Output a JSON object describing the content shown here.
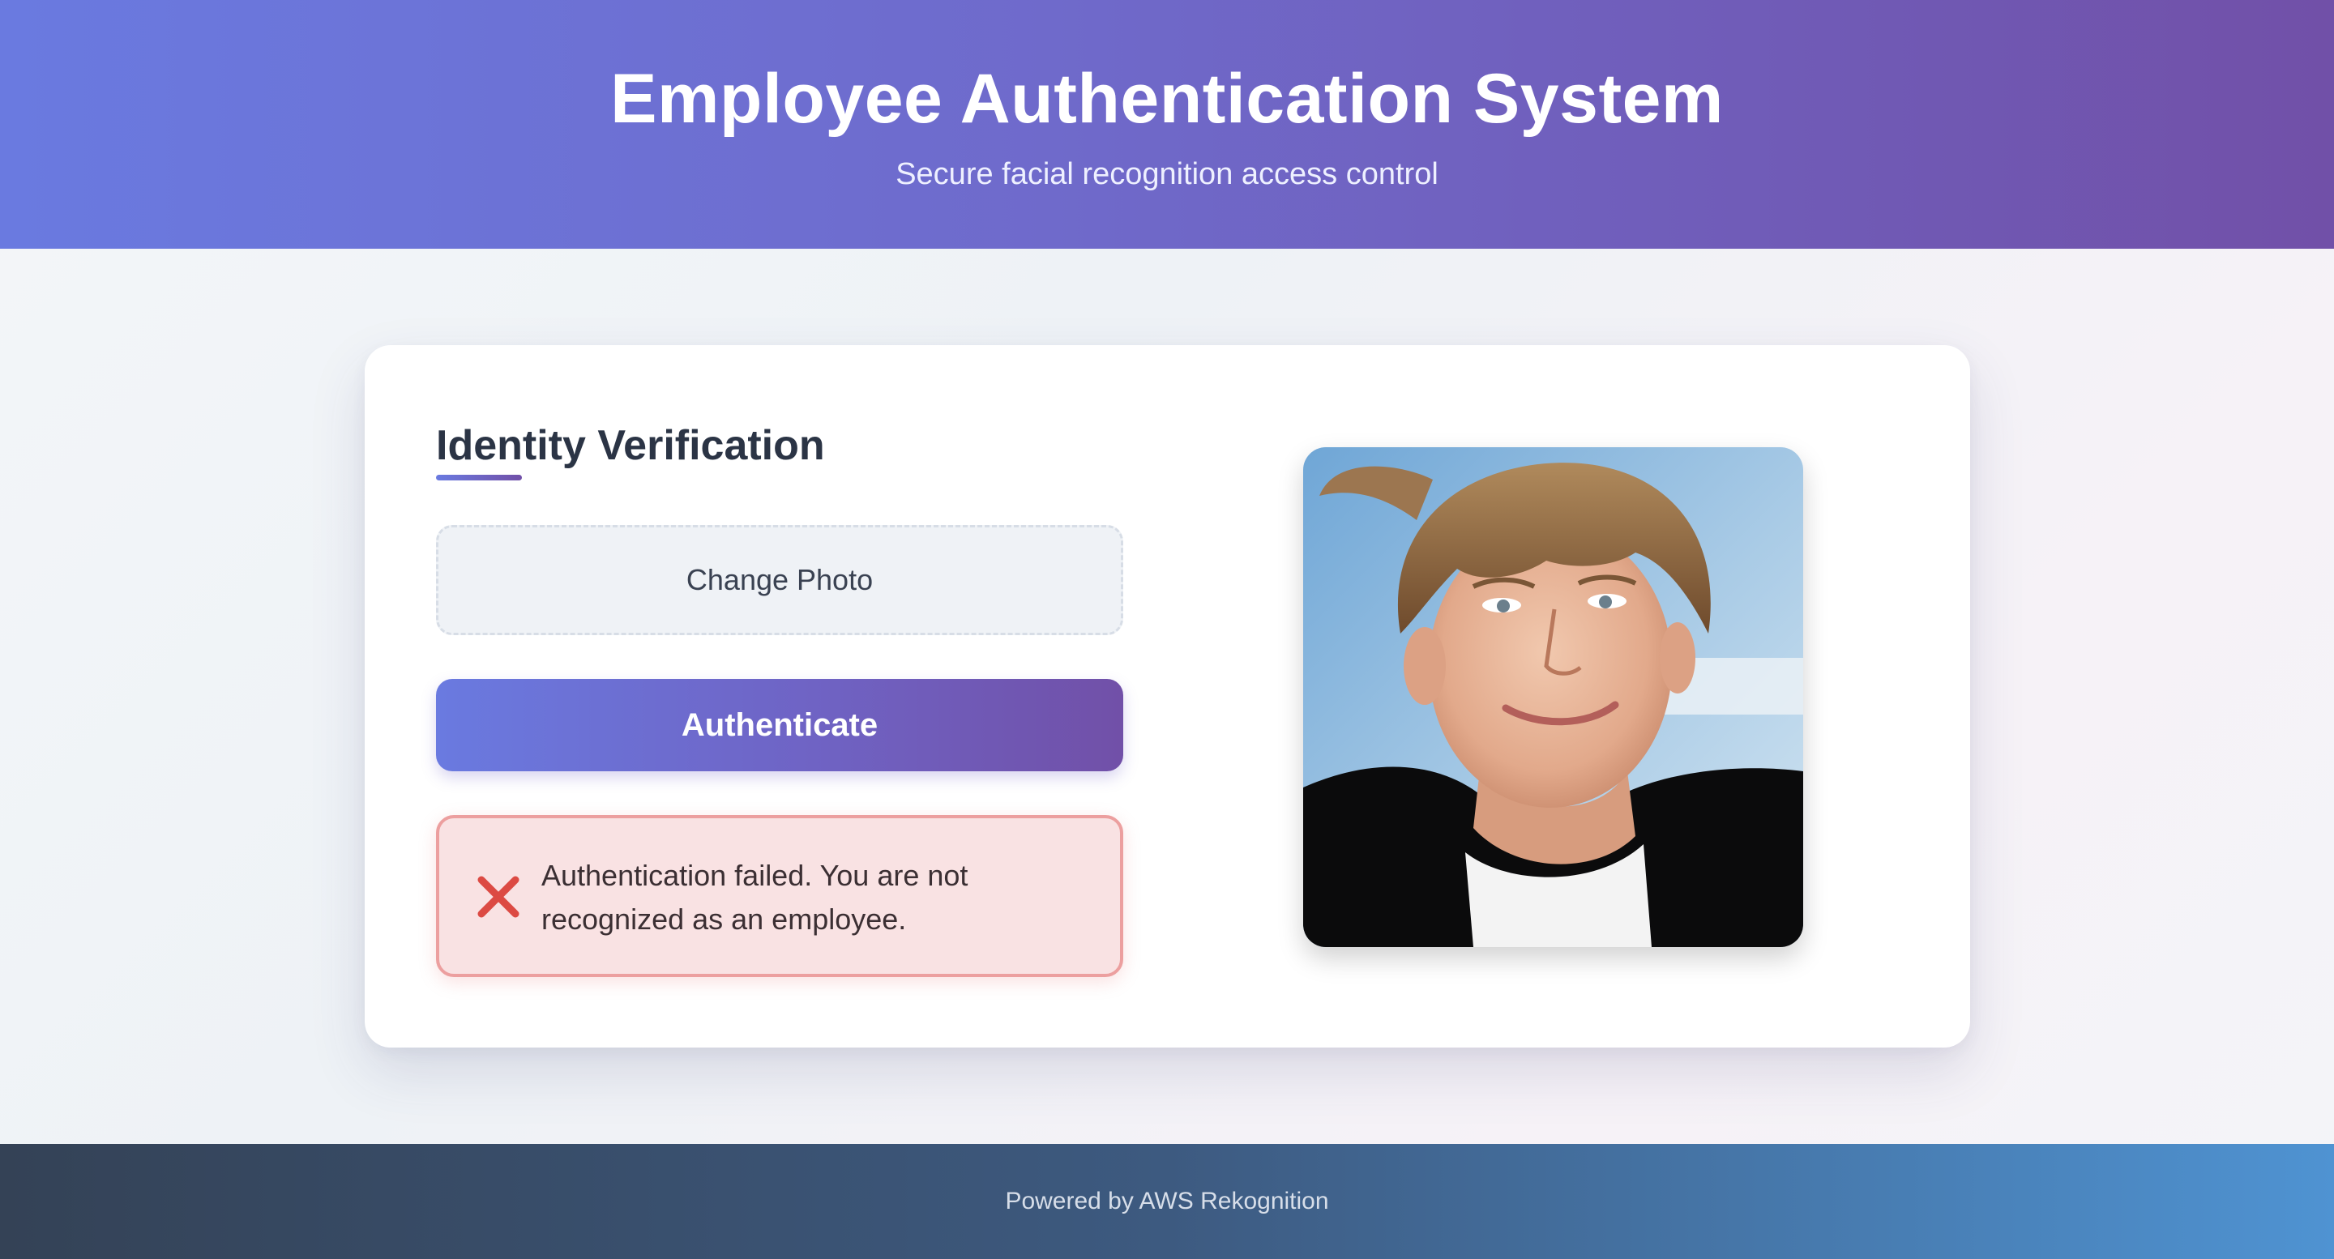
{
  "header": {
    "title": "Employee Authentication System",
    "subtitle": "Secure facial recognition access control"
  },
  "card": {
    "section_title": "Identity Verification",
    "change_photo_label": "Change Photo",
    "authenticate_label": "Authenticate",
    "error": {
      "icon": "x-mark-icon",
      "message": "Authentication failed. You are not recognized as an employee."
    },
    "photo": {
      "subject": "portrait-photo"
    }
  },
  "footer": {
    "text": "Powered by AWS Rekognition"
  },
  "colors": {
    "accent_start": "#6a7ae0",
    "accent_end": "#7150a8",
    "error_border": "#ec9f9f",
    "error_background": "#f9e2e3",
    "error_icon": "#dc4a43",
    "footer_start": "#344256",
    "footer_end": "#4f93d2"
  }
}
